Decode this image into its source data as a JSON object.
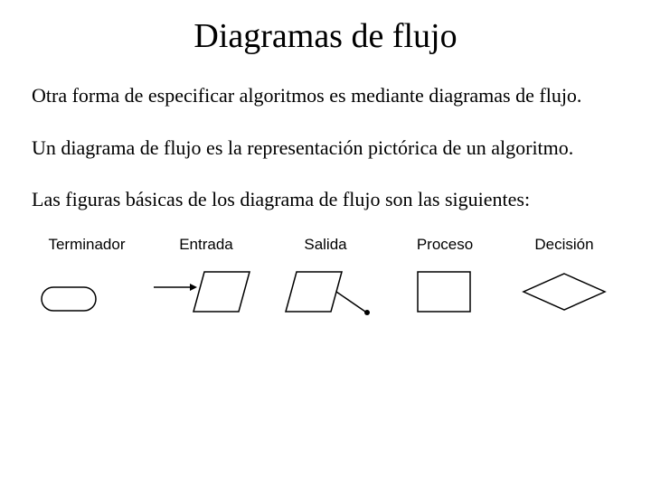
{
  "title": "Diagramas de flujo",
  "paragraphs": {
    "p1": "Otra forma de especificar algoritmos es mediante diagramas de flujo.",
    "p2": "Un diagrama de flujo es la representación pictórica de un algoritmo.",
    "p3": "Las figuras básicas de los diagrama de flujo son las siguientes:"
  },
  "shapes": {
    "terminator": "Terminador",
    "input": "Entrada",
    "output": "Salida",
    "process": "Proceso",
    "decision": "Decisión"
  }
}
